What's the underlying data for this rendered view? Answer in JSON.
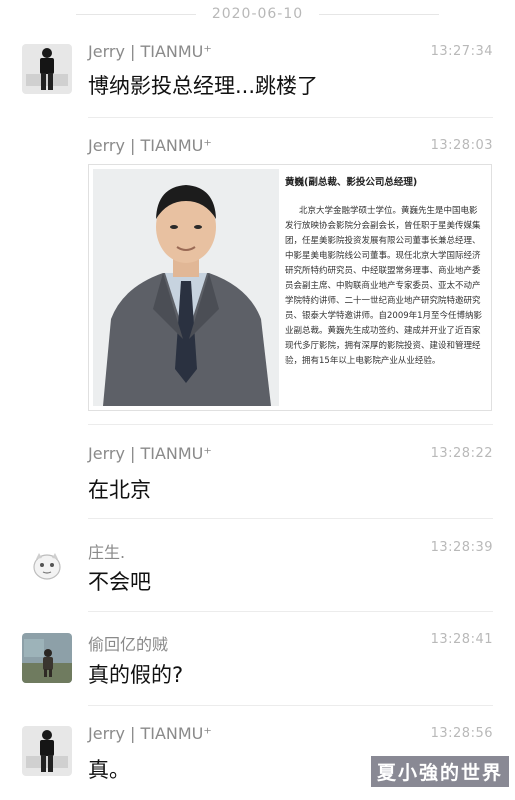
{
  "date": "2020-06-10",
  "messages": [
    {
      "sender": "Jerry | TIANMU⁺",
      "time": "13:27:34",
      "text": "博纳影投总经理...跳楼了"
    },
    {
      "sender": "Jerry | TIANMU⁺",
      "time": "13:28:03",
      "card": {
        "title": "黄巍(副总裁、影投公司总经理)",
        "body": "北京大学金融学硕士学位。黄巍先生是中国电影发行放映协会影院分会副会长，曾任职于星美传媒集团，任星美影院投资发展有限公司董事长兼总经理、中影星美电影院线公司董事。现任北京大学国际经济研究所特约研究员、中经联盟常务理事、商业地产委员会副主席、中购联商业地产专家委员、亚太不动产学院特约讲师、二十一世纪商业地产研究院特邀研究员、银泰大学特邀讲师。自2009年1月至今任博纳影业副总裁。黄巍先生成功签约、建成并开业了近百家现代多厅影院，拥有深厚的影院投资、建设和管理经验，拥有15年以上电影院产业从业经验。"
      }
    },
    {
      "sender": "Jerry | TIANMU⁺",
      "time": "13:28:22",
      "text": "在北京"
    },
    {
      "sender": "庄生.",
      "time": "13:28:39",
      "text": "不会吧"
    },
    {
      "sender": "偷回亿的贼",
      "time": "13:28:41",
      "text": "真的假的?"
    },
    {
      "sender": "Jerry | TIANMU⁺",
      "time": "13:28:56",
      "text": "真。"
    }
  ],
  "watermark": "夏小強的世界"
}
